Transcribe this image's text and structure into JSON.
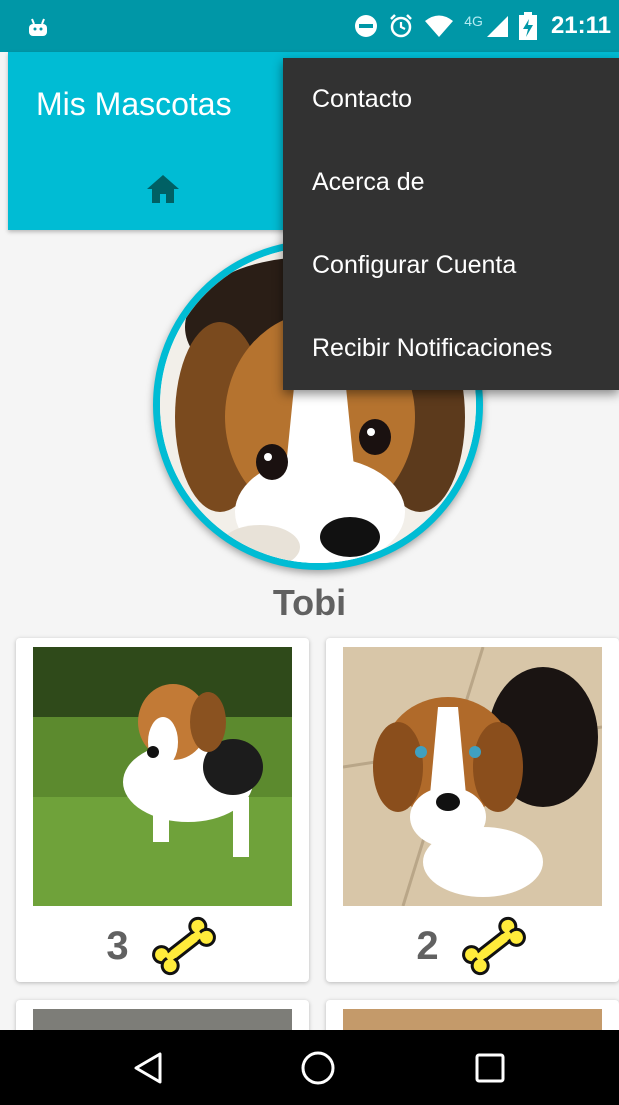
{
  "status_bar": {
    "time": "21:11",
    "network_type": "4G",
    "icons": [
      "android-icon",
      "do-not-disturb-icon",
      "alarm-icon",
      "wifi-icon",
      "signal-icon",
      "battery-charging-icon"
    ]
  },
  "app_bar": {
    "title": "Mis Mascotas",
    "tab_icon": "home-icon"
  },
  "overflow_menu": {
    "items": [
      {
        "label": "Contacto"
      },
      {
        "label": "Acerca de"
      },
      {
        "label": "Configurar Cuenta"
      },
      {
        "label": "Recibir Notificaciones"
      }
    ]
  },
  "profile": {
    "name": "Tobi"
  },
  "photos": [
    {
      "likes": "3",
      "icon": "bone-icon"
    },
    {
      "likes": "2",
      "icon": "bone-icon"
    }
  ],
  "nav_bar": {
    "icons": [
      "back-icon",
      "home-circle-icon",
      "recents-icon"
    ]
  },
  "colors": {
    "primary": "#00bcd4",
    "primary_dark": "#0097a7",
    "menu_bg": "#323232",
    "bone_fill": "#ffeb3b",
    "text_gray": "#616161"
  }
}
